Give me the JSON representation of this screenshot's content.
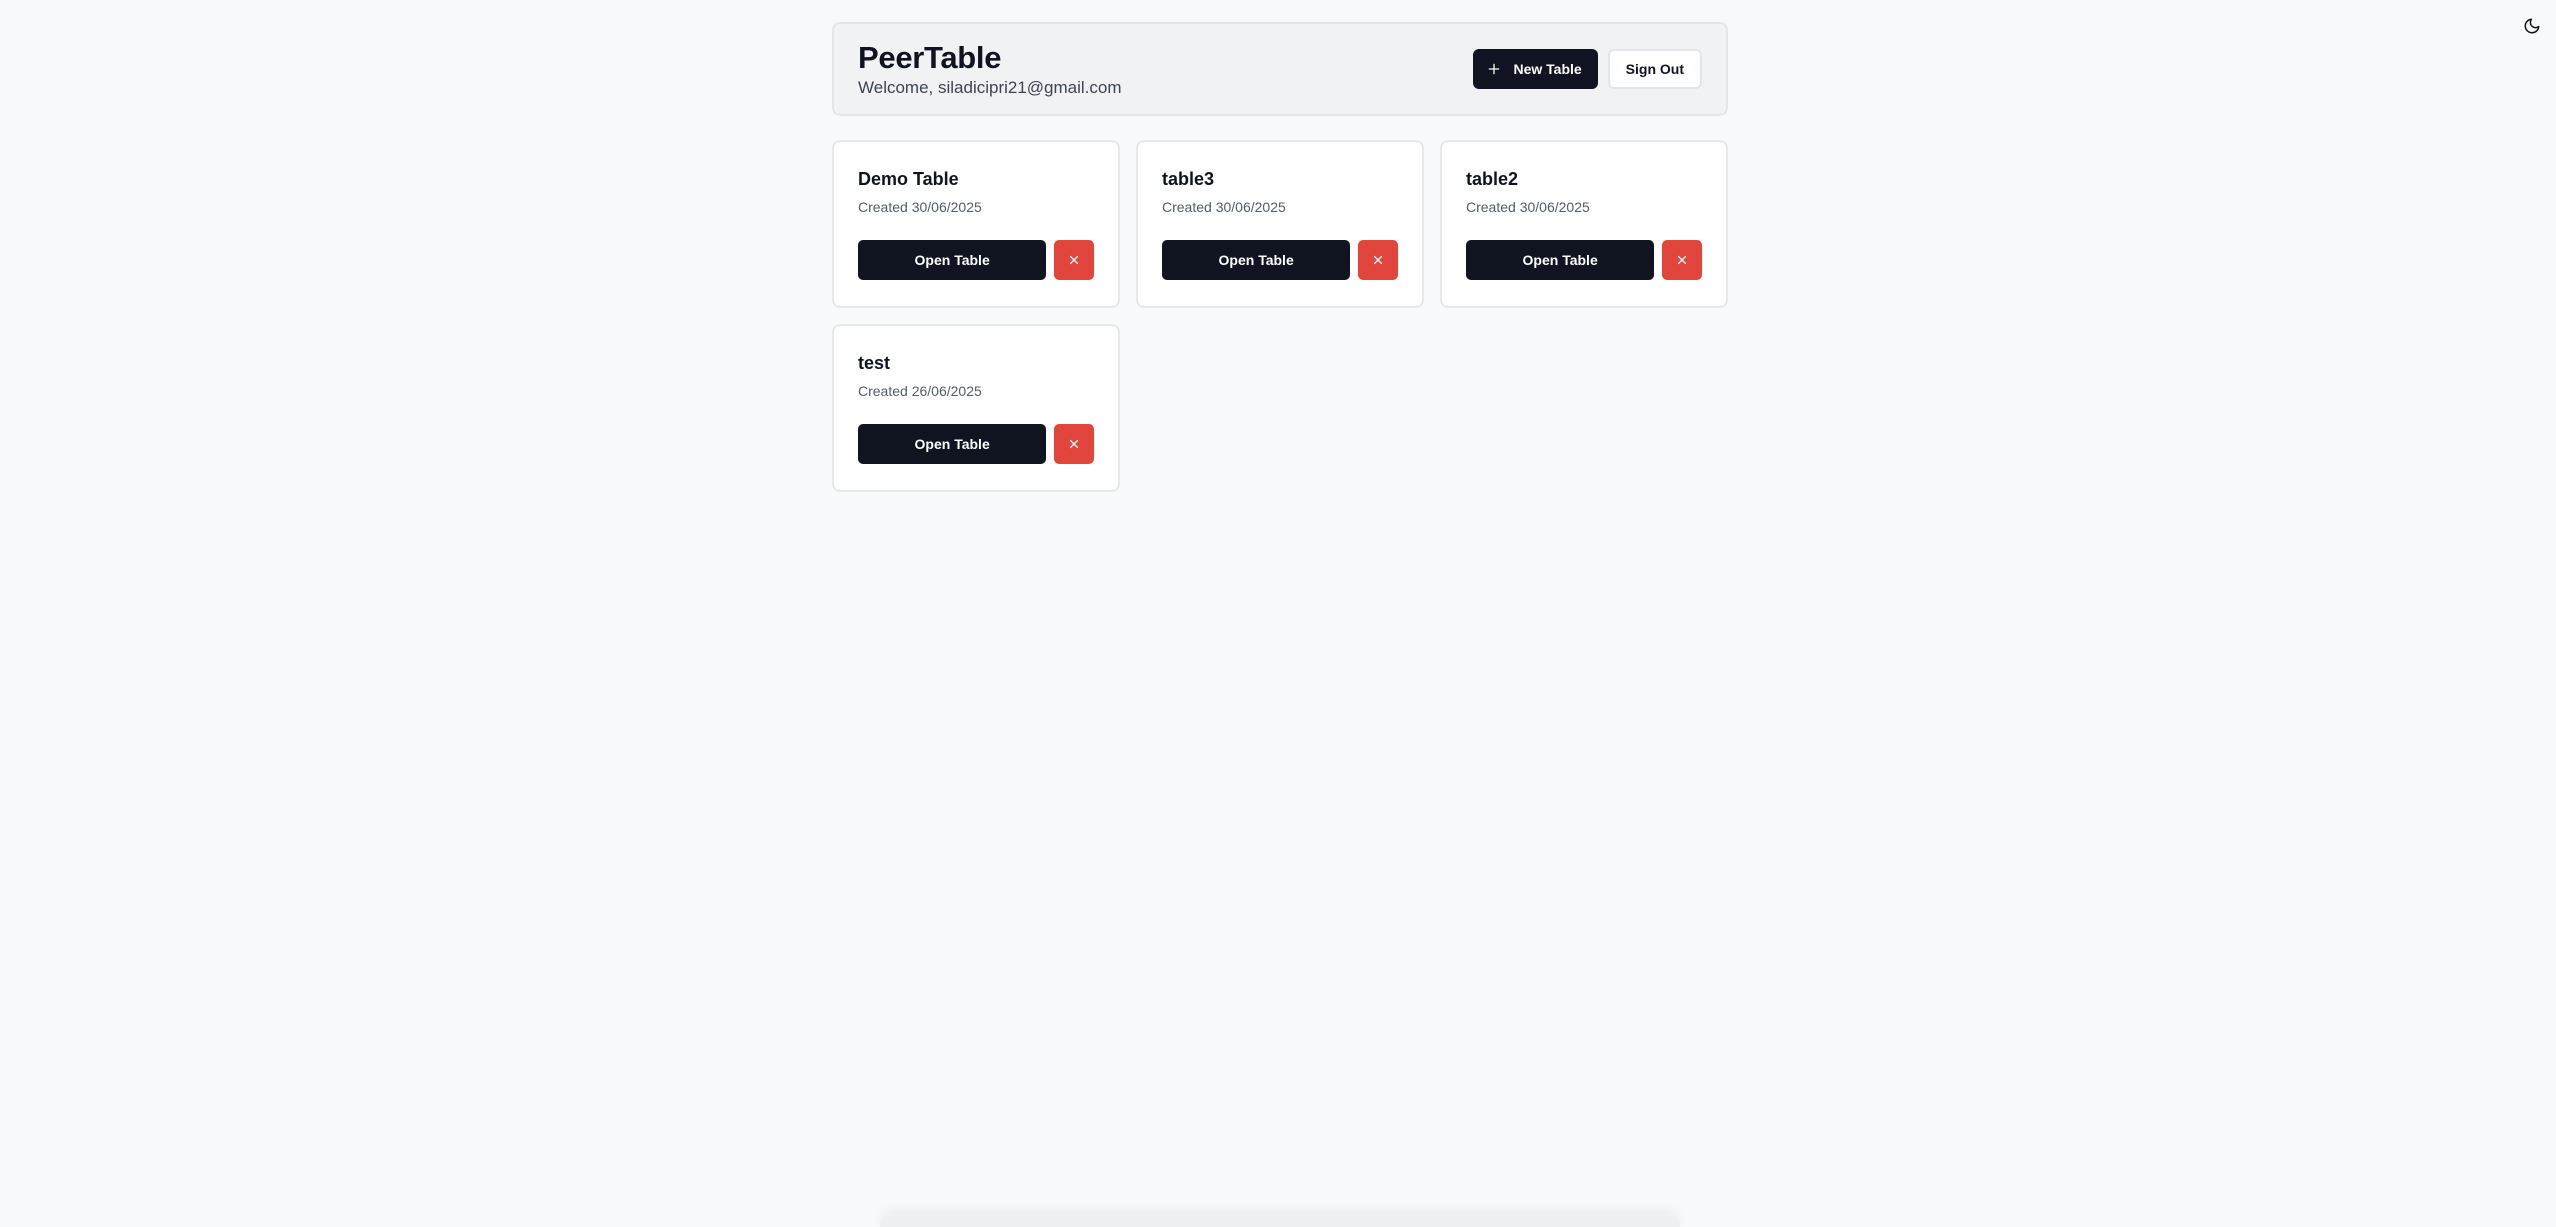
{
  "header": {
    "title": "PeerTable",
    "welcome": "Welcome, siladicipri21@gmail.com",
    "new_table_label": "New Table",
    "sign_out_label": "Sign Out"
  },
  "theme_toggle": {
    "icon": "moon-icon"
  },
  "tables": [
    {
      "name": "Demo Table",
      "created": "Created 30/06/2025",
      "open_label": "Open Table"
    },
    {
      "name": "table3",
      "created": "Created 30/06/2025",
      "open_label": "Open Table"
    },
    {
      "name": "table2",
      "created": "Created 30/06/2025",
      "open_label": "Open Table"
    },
    {
      "name": "test",
      "created": "Created 26/06/2025",
      "open_label": "Open Table"
    }
  ],
  "colors": {
    "primary": "#0f1420",
    "danger": "#e2453c",
    "background": "#f8f9fb"
  }
}
